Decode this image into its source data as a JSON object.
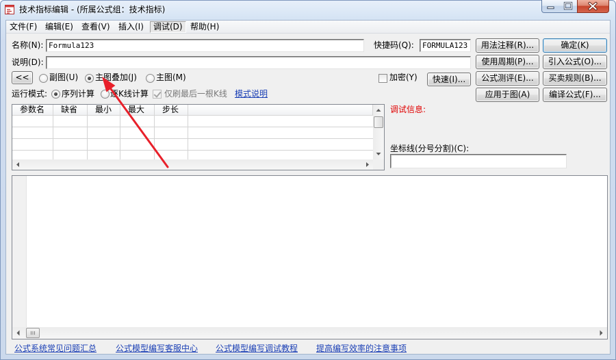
{
  "window": {
    "title": "技术指标编辑 - (所属公式组：技术指标)",
    "icons": {
      "app": "formula-editor-icon",
      "minimize": "minimize-icon",
      "maximize": "maximize-icon",
      "close": "close-icon"
    }
  },
  "menu": {
    "items": [
      {
        "label": "文件(F)",
        "active": false
      },
      {
        "label": "编辑(E)",
        "active": false
      },
      {
        "label": "查看(V)",
        "active": false
      },
      {
        "label": "插入(I)",
        "active": false
      },
      {
        "label": "调试(D)",
        "active": true
      },
      {
        "label": "帮助(H)",
        "active": false
      }
    ]
  },
  "form": {
    "name": {
      "label": "名称(N):",
      "value": "Formula123"
    },
    "shortcut": {
      "label": "快捷码(Q):",
      "value": "FORMULA123"
    },
    "description": {
      "label": "说明(D):",
      "value": ""
    },
    "collapse_button": "<<",
    "chart_type": [
      {
        "label": "副图(U)",
        "selected": false
      },
      {
        "label": "主图叠加(J)",
        "selected": true
      },
      {
        "label": "主图(M)",
        "selected": false
      }
    ],
    "encrypt": {
      "label": "加密(Y)",
      "checked": false
    },
    "quick_button": "快速(I)...",
    "run_mode": {
      "label": "运行模式:",
      "options": [
        {
          "label": "序列计算",
          "selected": true
        },
        {
          "label": "逐K线计算",
          "selected": false
        }
      ],
      "last_bar_only": {
        "label": "仅刷最后一根K线",
        "checked": true,
        "enabled": false
      },
      "help_link": "模式说明"
    }
  },
  "actions": {
    "usage_notes": "用法注释(R)...",
    "ok": "确定(K)",
    "periods": "使用周期(P)...",
    "import_formula": "引入公式(O)...",
    "evaluate": "公式测评(E)...",
    "trade_rules": "买卖规则(B)...",
    "apply_to_chart": "应用于图(A)",
    "compile": "编译公式(F)..."
  },
  "param_table": {
    "columns": [
      "参数名",
      "缺省",
      "最小",
      "最大",
      "步长"
    ]
  },
  "debug": {
    "info_label": "调试信息:",
    "axis_lines_label": "坐标线(分号分割)(C):",
    "axis_lines_value": ""
  },
  "editor": {
    "content": ""
  },
  "footer_links": [
    "公式系统常见问题汇总",
    "公式模型编写客服中心",
    "公式模型编写调试教程",
    "提高编写效率的注意事项"
  ],
  "colors": {
    "link": "#1a3fb5",
    "debug_label": "#e00000",
    "close_button": "#c7452c",
    "annotation_arrow": "#e8202a"
  }
}
